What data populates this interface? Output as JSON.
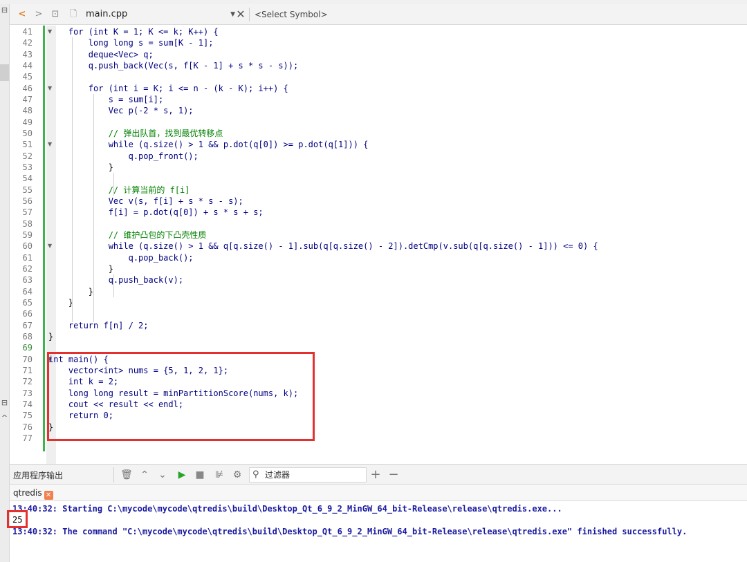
{
  "editor_toolbar": {
    "file_name": "main.cpp",
    "symbol_placeholder": "<Select Symbol>"
  },
  "code_lines": [
    {
      "n": "41",
      "fold": true
    },
    {
      "n": "42"
    },
    {
      "n": "43"
    },
    {
      "n": "44"
    },
    {
      "n": "45"
    },
    {
      "n": "46",
      "fold": true
    },
    {
      "n": "47"
    },
    {
      "n": "48"
    },
    {
      "n": "49"
    },
    {
      "n": "50"
    },
    {
      "n": "51",
      "fold": true
    },
    {
      "n": "52"
    },
    {
      "n": "53"
    },
    {
      "n": "54"
    },
    {
      "n": "55"
    },
    {
      "n": "56"
    },
    {
      "n": "57"
    },
    {
      "n": "58"
    },
    {
      "n": "59"
    },
    {
      "n": "60",
      "fold": true
    },
    {
      "n": "61"
    },
    {
      "n": "62"
    },
    {
      "n": "63"
    },
    {
      "n": "64"
    },
    {
      "n": "65"
    },
    {
      "n": "66"
    },
    {
      "n": "67"
    },
    {
      "n": "68"
    },
    {
      "n": "69"
    },
    {
      "n": "70",
      "fold": true
    },
    {
      "n": "71"
    },
    {
      "n": "72"
    },
    {
      "n": "73"
    },
    {
      "n": "74"
    },
    {
      "n": "75"
    },
    {
      "n": "76"
    },
    {
      "n": "77"
    }
  ],
  "code": {
    "l41": "    for (int K = 1; K <= k; K++) {",
    "l42": "        long long s = sum[K - 1];",
    "l43": "        deque<Vec> q;",
    "l44": "        q.push_back(Vec(s, f[K - 1] + s * s - s));",
    "l46": "        for (int i = K; i <= n - (k - K); i++) {",
    "l47": "            s = sum[i];",
    "l48": "            Vec p(-2 * s, 1);",
    "l50": "            // 弹出队首，找到最优转移点",
    "l51": "            while (q.size() > 1 && p.dot(q[0]) >= p.dot(q[1])) {",
    "l52": "                q.pop_front();",
    "l53": "            }",
    "l55": "            // 计算当前的 f[i]",
    "l56": "            Vec v(s, f[i] + s * s - s);",
    "l57": "            f[i] = p.dot(q[0]) + s * s + s;",
    "l59": "            // 维护凸包的下凸壳性质",
    "l60": "            while (q.size() > 1 && q[q.size() - 1].sub(q[q.size() - 2]).detCmp(v.sub(q[q.size() - 1])) <= 0) {",
    "l61": "                q.pop_back();",
    "l62": "            }",
    "l63": "            q.push_back(v);",
    "l64": "        }",
    "l65": "    }",
    "l67": "    return f[n] / 2;",
    "l68": "}",
    "l70": "int main() {",
    "l71": "    vector<int> nums = {5, 1, 2, 1};",
    "l72": "    int k = 2;",
    "l73": "    long long result = minPartitionScore(nums, k);",
    "l74": "    cout << result << endl;",
    "l75": "    return 0;",
    "l76": "}"
  },
  "output_pane": {
    "title": "应用程序输出",
    "filter_placeholder": "过滤器",
    "tab_label": "qtredis",
    "lines": {
      "start": "13:40:32: Starting C:\\mycode\\mycode\\qtredis\\build\\Desktop_Qt_6_9_2_MinGW_64_bit-Release\\release\\qtredis.exe...",
      "result": "25",
      "finish": "13:40:32: The command \"C:\\mycode\\mycode\\qtredis\\build\\Desktop_Qt_6_9_2_MinGW_64_bit-Release\\release\\qtredis.exe\" finished successfully."
    }
  },
  "colors": {
    "highlight_box": "#e53030",
    "changebar": "#3db54a",
    "output_text": "#1a1aa0"
  }
}
